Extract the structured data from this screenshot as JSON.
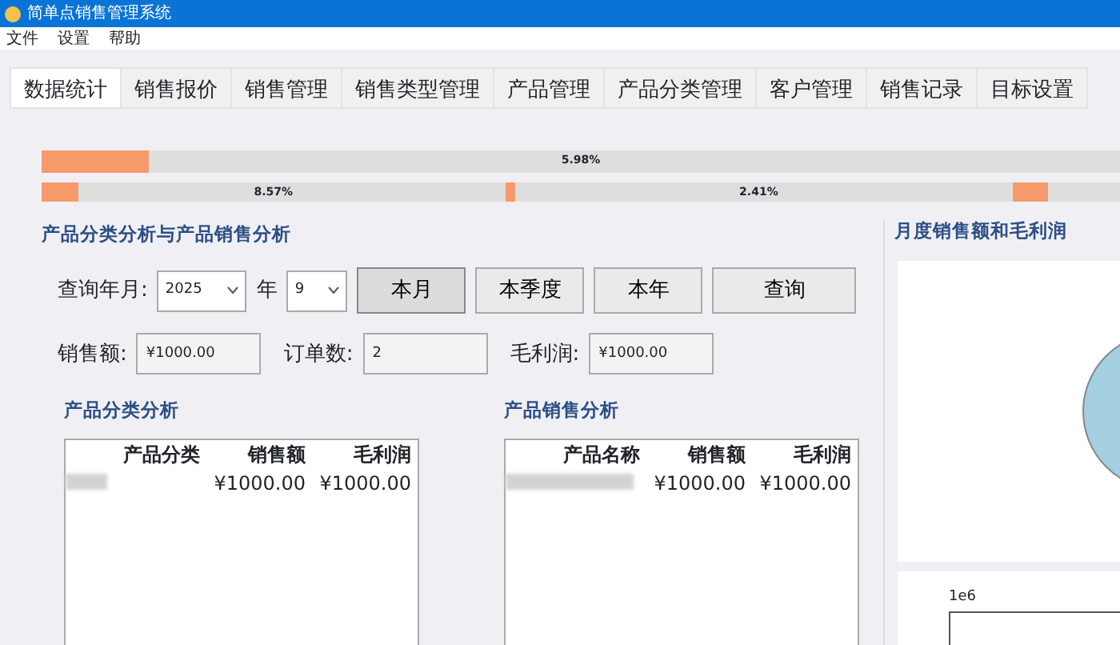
{
  "window": {
    "title": "简单点销售管理系统"
  },
  "menu": [
    "文件",
    "设置",
    "帮助"
  ],
  "tabs": [
    {
      "label": "数据统计",
      "selected": true
    },
    {
      "label": "销售报价",
      "selected": false
    },
    {
      "label": "销售管理",
      "selected": false
    },
    {
      "label": "销售类型管理",
      "selected": false
    },
    {
      "label": "产品管理",
      "selected": false
    },
    {
      "label": "产品分类管理",
      "selected": false
    },
    {
      "label": "客户管理",
      "selected": false
    },
    {
      "label": "销售记录",
      "selected": false
    },
    {
      "label": "目标设置",
      "selected": false
    }
  ],
  "progress_rows": [
    [
      {
        "level": 0.1,
        "reading": "5.98%"
      }
    ],
    [
      {
        "level": 0.08,
        "reading": "8.57%"
      },
      {
        "level": 0.02,
        "reading": "2.41%"
      },
      {
        "level": 0.33
      }
    ]
  ],
  "section_title": "产品分类分析与产品销售分析",
  "query": {
    "label": "查询年月:",
    "year": "2025",
    "year_unit": "年",
    "month": "9",
    "buttons": [
      {
        "label": "本月",
        "selected": true
      },
      {
        "label": "本季度",
        "selected": false
      },
      {
        "label": "本年",
        "selected": false
      },
      {
        "label": "查询",
        "selected": false
      }
    ]
  },
  "totals": [
    {
      "label": "销售额:",
      "value": "¥1000.00"
    },
    {
      "label": "订单数:",
      "value": "2"
    },
    {
      "label": "毛利润:",
      "value": "¥1000.00"
    }
  ],
  "tables": [
    {
      "title": "产品分类分析",
      "columns": [
        "产品分类",
        "销售额",
        "毛利润"
      ],
      "rows": [
        [
          "",
          "¥1000.00",
          "¥1000.00"
        ]
      ]
    },
    {
      "title": "产品销售分析",
      "columns": [
        "产品名称",
        "销售额",
        "毛利润"
      ],
      "rows": [
        [
          "",
          "¥1000.00",
          "¥1000.00"
        ]
      ]
    }
  ],
  "right_panel": {
    "title": "月度销售额和毛利润",
    "axis_scale": "1e6"
  }
}
